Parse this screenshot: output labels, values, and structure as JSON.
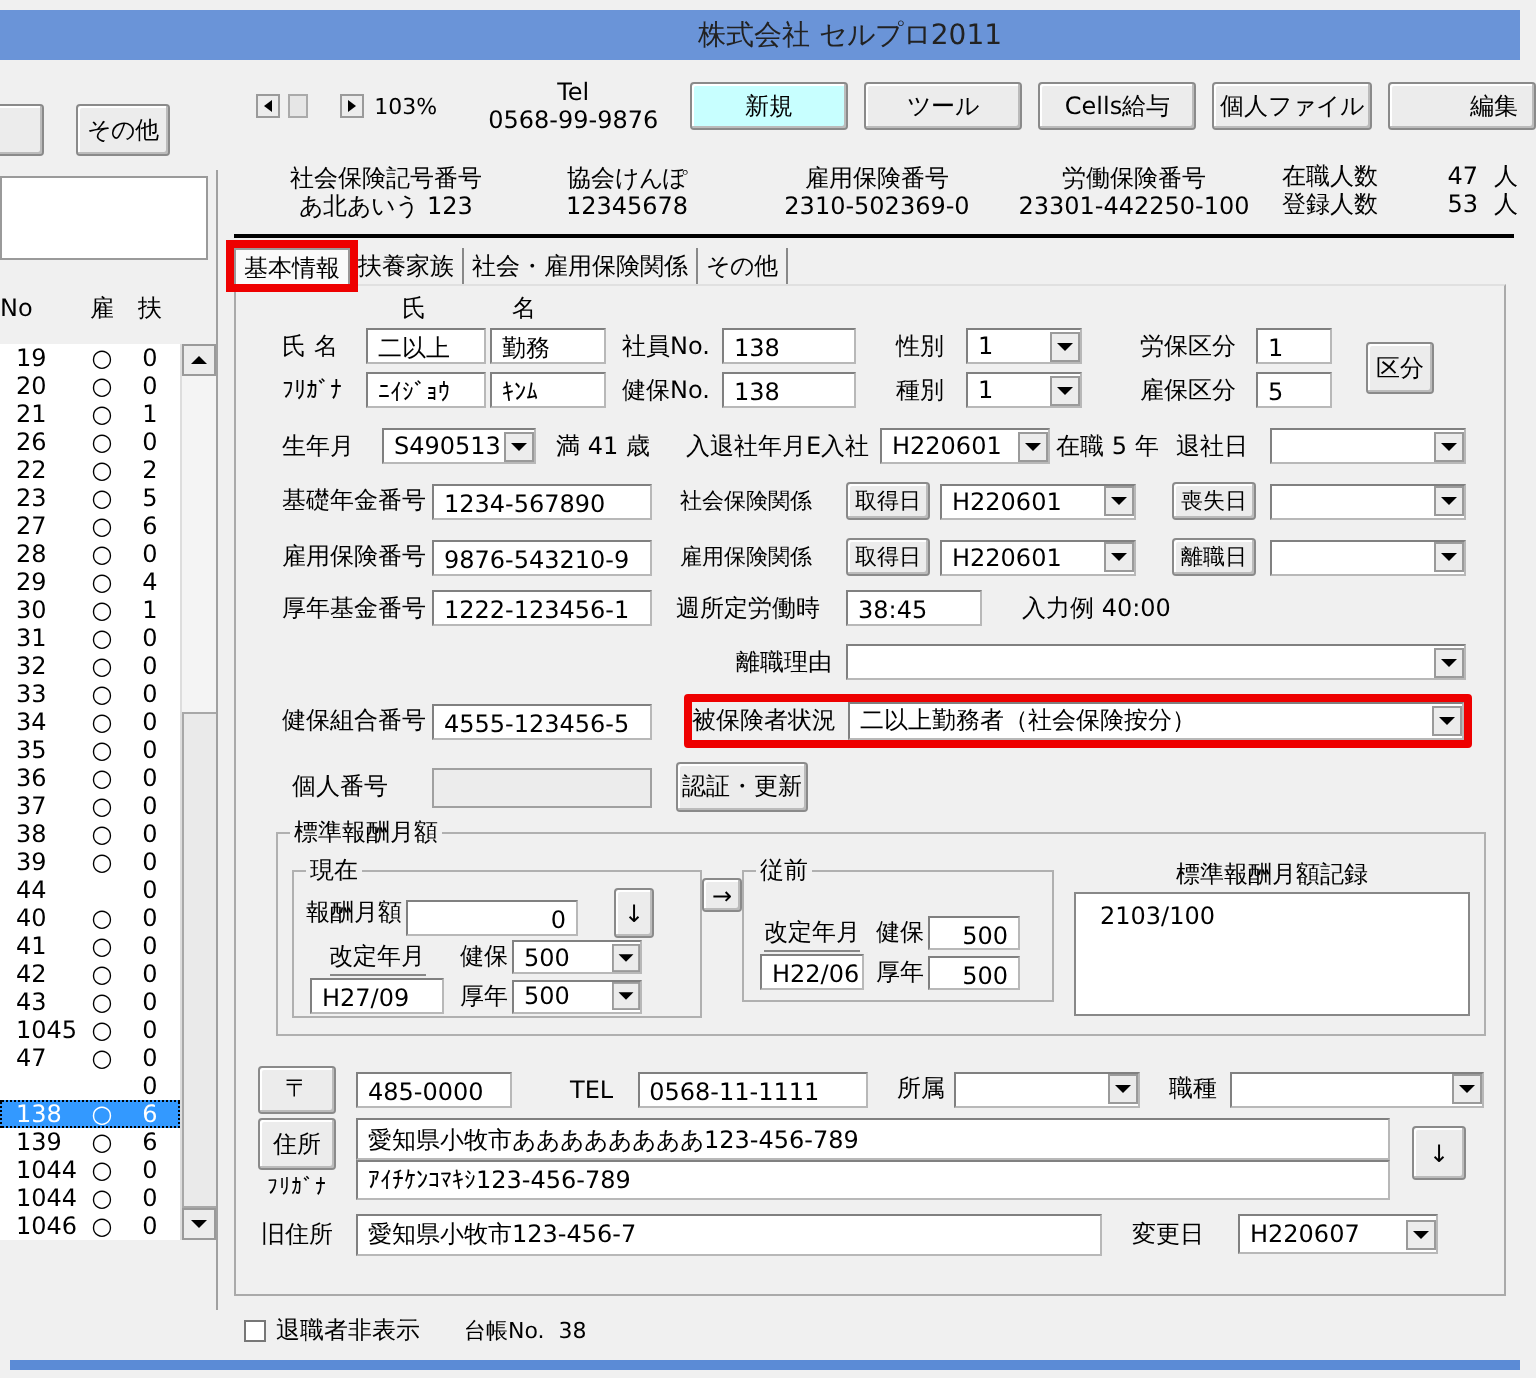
{
  "window": {
    "title": "株式会社 セルプロ2011"
  },
  "sidebar": {
    "buttons": [
      "その他"
    ],
    "columns": [
      "No",
      "雇",
      "扶"
    ],
    "rows": [
      {
        "no": "19",
        "koyo": "○",
        "fuyo": "0",
        "selected": false
      },
      {
        "no": "20",
        "koyo": "○",
        "fuyo": "0",
        "selected": false
      },
      {
        "no": "21",
        "koyo": "○",
        "fuyo": "1",
        "selected": false
      },
      {
        "no": "26",
        "koyo": "○",
        "fuyo": "0",
        "selected": false
      },
      {
        "no": "22",
        "koyo": "○",
        "fuyo": "2",
        "selected": false
      },
      {
        "no": "23",
        "koyo": "○",
        "fuyo": "5",
        "selected": false
      },
      {
        "no": "27",
        "koyo": "○",
        "fuyo": "6",
        "selected": false
      },
      {
        "no": "28",
        "koyo": "○",
        "fuyo": "0",
        "selected": false
      },
      {
        "no": "29",
        "koyo": "○",
        "fuyo": "4",
        "selected": false
      },
      {
        "no": "30",
        "koyo": "○",
        "fuyo": "1",
        "selected": false
      },
      {
        "no": "31",
        "koyo": "○",
        "fuyo": "0",
        "selected": false
      },
      {
        "no": "32",
        "koyo": "○",
        "fuyo": "0",
        "selected": false
      },
      {
        "no": "33",
        "koyo": "○",
        "fuyo": "0",
        "selected": false
      },
      {
        "no": "34",
        "koyo": "○",
        "fuyo": "0",
        "selected": false
      },
      {
        "no": "35",
        "koyo": "○",
        "fuyo": "0",
        "selected": false
      },
      {
        "no": "36",
        "koyo": "○",
        "fuyo": "0",
        "selected": false
      },
      {
        "no": "37",
        "koyo": "○",
        "fuyo": "0",
        "selected": false
      },
      {
        "no": "38",
        "koyo": "○",
        "fuyo": "0",
        "selected": false
      },
      {
        "no": "39",
        "koyo": "○",
        "fuyo": "0",
        "selected": false
      },
      {
        "no": "44",
        "fuyo": "0",
        "selected": false
      },
      {
        "no": "40",
        "koyo": "○",
        "fuyo": "0",
        "selected": false
      },
      {
        "no": "41",
        "koyo": "○",
        "fuyo": "0",
        "selected": false
      },
      {
        "no": "42",
        "koyo": "○",
        "fuyo": "0",
        "selected": false
      },
      {
        "no": "43",
        "koyo": "○",
        "fuyo": "0",
        "selected": false
      },
      {
        "no": "1045",
        "koyo": "○",
        "fuyo": "0",
        "selected": false
      },
      {
        "no": "47",
        "koyo": "○",
        "fuyo": "0",
        "selected": false
      },
      {
        "fuyo": "0",
        "selected": false
      },
      {
        "no": "138",
        "koyo": "○",
        "fuyo": "6",
        "selected": true
      },
      {
        "no": "139",
        "koyo": "○",
        "fuyo": "6",
        "selected": false
      },
      {
        "no": "1044",
        "koyo": "○",
        "fuyo": "0",
        "selected": false
      },
      {
        "no": "1044",
        "koyo": "○",
        "fuyo": "0",
        "selected": false
      },
      {
        "no": "1046",
        "koyo": "○",
        "fuyo": "0",
        "selected": false
      }
    ]
  },
  "toolbar": {
    "zoom": "103%",
    "tel_label": "Tel",
    "tel": "0568-99-9876",
    "buttons": [
      {
        "label": "新規",
        "highlighted": true
      },
      {
        "label": "ツール",
        "highlighted": false
      },
      {
        "label": "Cells給与",
        "highlighted": false
      },
      {
        "label": "個人ファイル",
        "highlighted": false
      },
      {
        "label": "編集",
        "highlighted": false
      }
    ]
  },
  "summary": [
    {
      "label": "社会保険記号番号",
      "value": "あ北あいう 123"
    },
    {
      "label": "協会けんぽ",
      "value": "12345678"
    },
    {
      "label": "雇用保険番号",
      "value": "2310-502369-0"
    },
    {
      "label": "労働保険番号",
      "value": "23301-442250-100"
    }
  ],
  "headcount": [
    {
      "label": "在職人数",
      "value": "47",
      "unit": "人"
    },
    {
      "label": "登録人数",
      "value": "53",
      "unit": "人"
    }
  ],
  "tabs": [
    {
      "label": "基本情報",
      "selected": true,
      "marked": true
    },
    {
      "label": "扶養家族",
      "selected": false,
      "marked": false
    },
    {
      "label": "社会・雇用保険関係",
      "selected": false,
      "marked": false
    },
    {
      "label": "その他",
      "selected": false,
      "marked": false
    }
  ],
  "form": {
    "kubun_button": "区分",
    "rows": [
      {
        "items": [
          {
            "kind": "label",
            "text": "氏"
          },
          {
            "kind": "label",
            "text": "名"
          }
        ]
      },
      {
        "items": [
          {
            "kind": "label",
            "text": "氏 名"
          },
          {
            "kind": "input",
            "value": "二以上",
            "disabled": false
          },
          {
            "kind": "input",
            "value": "勤務",
            "disabled": false
          },
          {
            "kind": "label",
            "text": "社員No."
          },
          {
            "kind": "input",
            "value": "138",
            "disabled": false
          },
          {
            "kind": "label",
            "text": "性別"
          },
          {
            "kind": "select",
            "value": "1"
          },
          {
            "kind": "label",
            "text": "労保区分"
          },
          {
            "kind": "input",
            "value": "1",
            "disabled": false
          }
        ]
      },
      {
        "items": [
          {
            "kind": "label",
            "text": "ﾌﾘｶﾞﾅ"
          },
          {
            "kind": "input",
            "value": "ﾆｲｼﾞｮｳ",
            "disabled": false
          },
          {
            "kind": "input",
            "value": "ｷﾝﾑ",
            "disabled": false
          },
          {
            "kind": "label",
            "text": "健保No."
          },
          {
            "kind": "input",
            "value": "138",
            "disabled": false
          },
          {
            "kind": "label",
            "text": "種別"
          },
          {
            "kind": "select",
            "value": "1"
          },
          {
            "kind": "label",
            "text": "雇保区分"
          },
          {
            "kind": "input",
            "value": "5",
            "disabled": false
          }
        ]
      },
      {
        "items": [
          {
            "kind": "label",
            "text": "生年月"
          },
          {
            "kind": "select",
            "value": "S490513"
          },
          {
            "kind": "label",
            "text": "満 41 歳"
          },
          {
            "kind": "label",
            "text": "入退社年月E入社"
          },
          {
            "kind": "select",
            "value": "H220601"
          },
          {
            "kind": "label",
            "text": "在職 5 年"
          },
          {
            "kind": "label",
            "text": "退社日"
          },
          {
            "kind": "select"
          }
        ]
      },
      {
        "items": [
          {
            "kind": "label",
            "text": "基礎年金番号"
          },
          {
            "kind": "input",
            "value": "1234-567890",
            "disabled": false
          },
          {
            "kind": "label",
            "text": "社会保険関係"
          },
          {
            "kind": "button",
            "text": "取得日"
          },
          {
            "kind": "select",
            "value": "H220601"
          },
          {
            "kind": "button",
            "text": "喪失日"
          },
          {
            "kind": "select"
          }
        ]
      },
      {
        "items": [
          {
            "kind": "label",
            "text": "雇用保険番号"
          },
          {
            "kind": "input",
            "value": "9876-543210-9",
            "disabled": false
          },
          {
            "kind": "label",
            "text": "雇用保険関係"
          },
          {
            "kind": "button",
            "text": "取得日"
          },
          {
            "kind": "select",
            "value": "H220601"
          },
          {
            "kind": "button",
            "text": "離職日"
          },
          {
            "kind": "select"
          }
        ]
      },
      {
        "items": [
          {
            "kind": "label",
            "text": "厚年基金番号"
          },
          {
            "kind": "input",
            "value": "1222-123456-1",
            "disabled": false
          },
          {
            "kind": "label",
            "text": "週所定労働時"
          },
          {
            "kind": "input",
            "value": "38:45",
            "disabled": false
          },
          {
            "kind": "label",
            "text": "入力例 40:00"
          }
        ]
      },
      {
        "items": [
          {
            "kind": "label",
            "text": "離職理由"
          },
          {
            "kind": "select"
          }
        ]
      },
      {
        "items": [
          {
            "kind": "label",
            "text": "健保組合番号"
          },
          {
            "kind": "input",
            "value": "4555-123456-5",
            "disabled": false
          },
          {
            "kind": "group",
            "marked": true,
            "items": [
              {
                "kind": "label",
                "text": "被保険者状況"
              },
              {
                "kind": "select",
                "value": "二以上勤務者（社会保険按分）"
              }
            ]
          }
        ]
      },
      {
        "items": [
          {
            "kind": "label",
            "text": "個人番号"
          },
          {
            "kind": "input",
            "disabled": true
          },
          {
            "kind": "button",
            "text": "認証・更新"
          }
        ]
      }
    ]
  },
  "standard_pay": {
    "title": "標準報酬月額",
    "current": {
      "title": "現在",
      "pay_label": "報酬月額",
      "pay": "0",
      "down_button": "↓",
      "revised_label": "改定年月",
      "revised": "H27/09",
      "health_label": "健保",
      "health": "500",
      "pension_label": "厚年",
      "pension": "500"
    },
    "move_button": "→",
    "previous": {
      "title": "従前",
      "revised_label": "改定年月",
      "revised": "H22/06",
      "health_label": "健保",
      "health": "500",
      "pension_label": "厚年",
      "pension": "500"
    },
    "record": {
      "title": "標準報酬月額記録",
      "items": [
        "2103/100"
      ]
    }
  },
  "address": {
    "postal_button": "〒",
    "postal": "485-0000",
    "tel_label": "TEL",
    "tel": "0568-11-1111",
    "dept_label": "所属",
    "job_label": "職種",
    "address_button": "住所",
    "address": "愛知県小牧市ああああああああ123-456-789",
    "kana_label": "ﾌﾘｶﾞﾅ",
    "kana": "ｱｲﾁｹﾝｺﾏｷｼ123-456-789",
    "copy_button": "↓",
    "old_label": "旧住所",
    "old_address": "愛知県小牧市123-456-7",
    "changed_label": "変更日",
    "changed": "H220607"
  },
  "footer": {
    "hide_retired": {
      "label": "退職者非表示",
      "checked": false
    },
    "ledger": "台帳No.  38"
  }
}
